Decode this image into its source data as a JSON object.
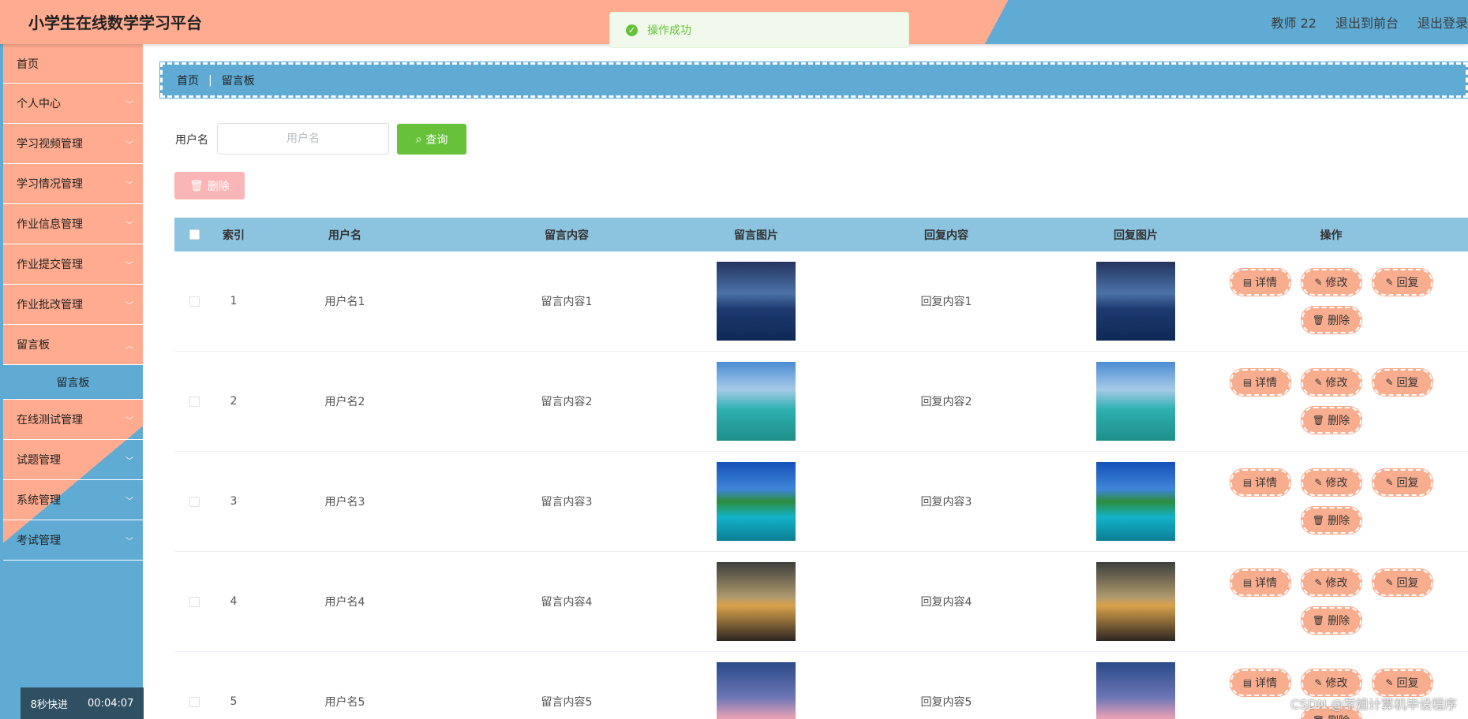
{
  "header": {
    "title": "小学生在线数学学习平台",
    "user": "教师 22",
    "back_front": "退出到前台",
    "logout": "退出登录"
  },
  "toast": {
    "message": "操作成功"
  },
  "sidebar": {
    "items": [
      {
        "label": "首页"
      },
      {
        "label": "个人中心"
      },
      {
        "label": "学习视频管理"
      },
      {
        "label": "学习情况管理"
      },
      {
        "label": "作业信息管理"
      },
      {
        "label": "作业提交管理"
      },
      {
        "label": "作业批改管理"
      },
      {
        "label": "留言板"
      },
      {
        "label": "在线测试管理"
      },
      {
        "label": "试题管理"
      },
      {
        "label": "系统管理"
      },
      {
        "label": "考试管理"
      }
    ],
    "active_sub": "留言板"
  },
  "timer": {
    "label": "8秒快进",
    "time": "00:04:07"
  },
  "breadcrumb": {
    "home": "首页",
    "current": "留言板"
  },
  "search": {
    "label": "用户名",
    "placeholder": "用户名",
    "query_label": "查询",
    "delete_label": "删除"
  },
  "table": {
    "headers": {
      "index": "索引",
      "username": "用户名",
      "content": "留言内容",
      "image": "留言图片",
      "reply": "回复内容",
      "reply_image": "回复图片",
      "ops": "操作"
    },
    "rows": [
      {
        "index": "1",
        "username": "用户名1",
        "content": "留言内容1",
        "reply": "回复内容1"
      },
      {
        "index": "2",
        "username": "用户名2",
        "content": "留言内容2",
        "reply": "回复内容2"
      },
      {
        "index": "3",
        "username": "用户名3",
        "content": "留言内容3",
        "reply": "回复内容3"
      },
      {
        "index": "4",
        "username": "用户名4",
        "content": "留言内容4",
        "reply": "回复内容4"
      },
      {
        "index": "5",
        "username": "用户名5",
        "content": "留言内容5",
        "reply": "回复内容5"
      }
    ],
    "op_labels": {
      "detail": "详情",
      "edit": "修改",
      "reply": "回复",
      "delete": "删除"
    }
  },
  "watermark": "CSDN @学姐计算机毕设程序"
}
